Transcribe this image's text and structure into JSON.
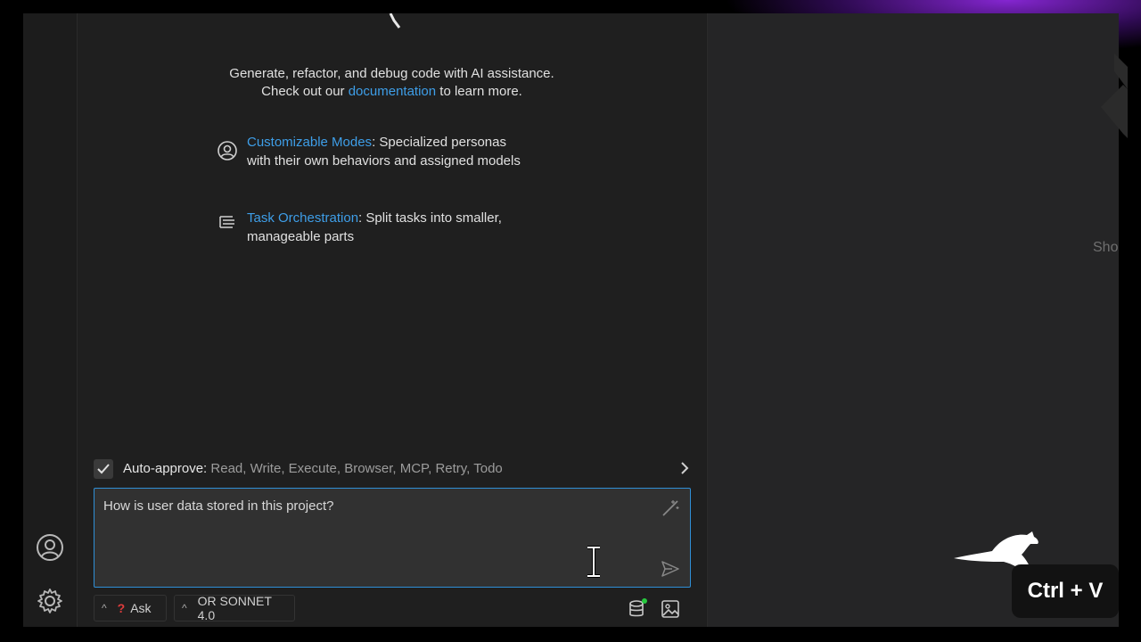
{
  "intro": {
    "line1": "Generate, refactor, and debug code with AI assistance.",
    "line2_prefix": "Check out our ",
    "line2_link": "documentation",
    "line2_suffix": " to learn more."
  },
  "features": [
    {
      "icon": "user-circle-icon",
      "title": "Customizable Modes",
      "desc": ": Specialized personas with their own behaviors and assigned models"
    },
    {
      "icon": "task-list-icon",
      "title": "Task Orchestration",
      "desc": ": Split tasks into smaller, manageable parts"
    }
  ],
  "auto_approve": {
    "label": "Auto-approve:",
    "items": " Read, Write, Execute, Browser, MCP, Retry, Todo",
    "checked": true
  },
  "chat_input": {
    "value": "How is user data stored in this project?"
  },
  "bottom_bar": {
    "mode_label": "Ask",
    "model_label": "OR SONNET 4.0"
  },
  "overlay": {
    "shortcut": "Ctrl + V",
    "side_text": "Sho"
  },
  "colors": {
    "accent": "#2f8fd6",
    "link": "#3e9ee8",
    "glow": "#8c28dc",
    "status_dot": "#27c93f"
  }
}
